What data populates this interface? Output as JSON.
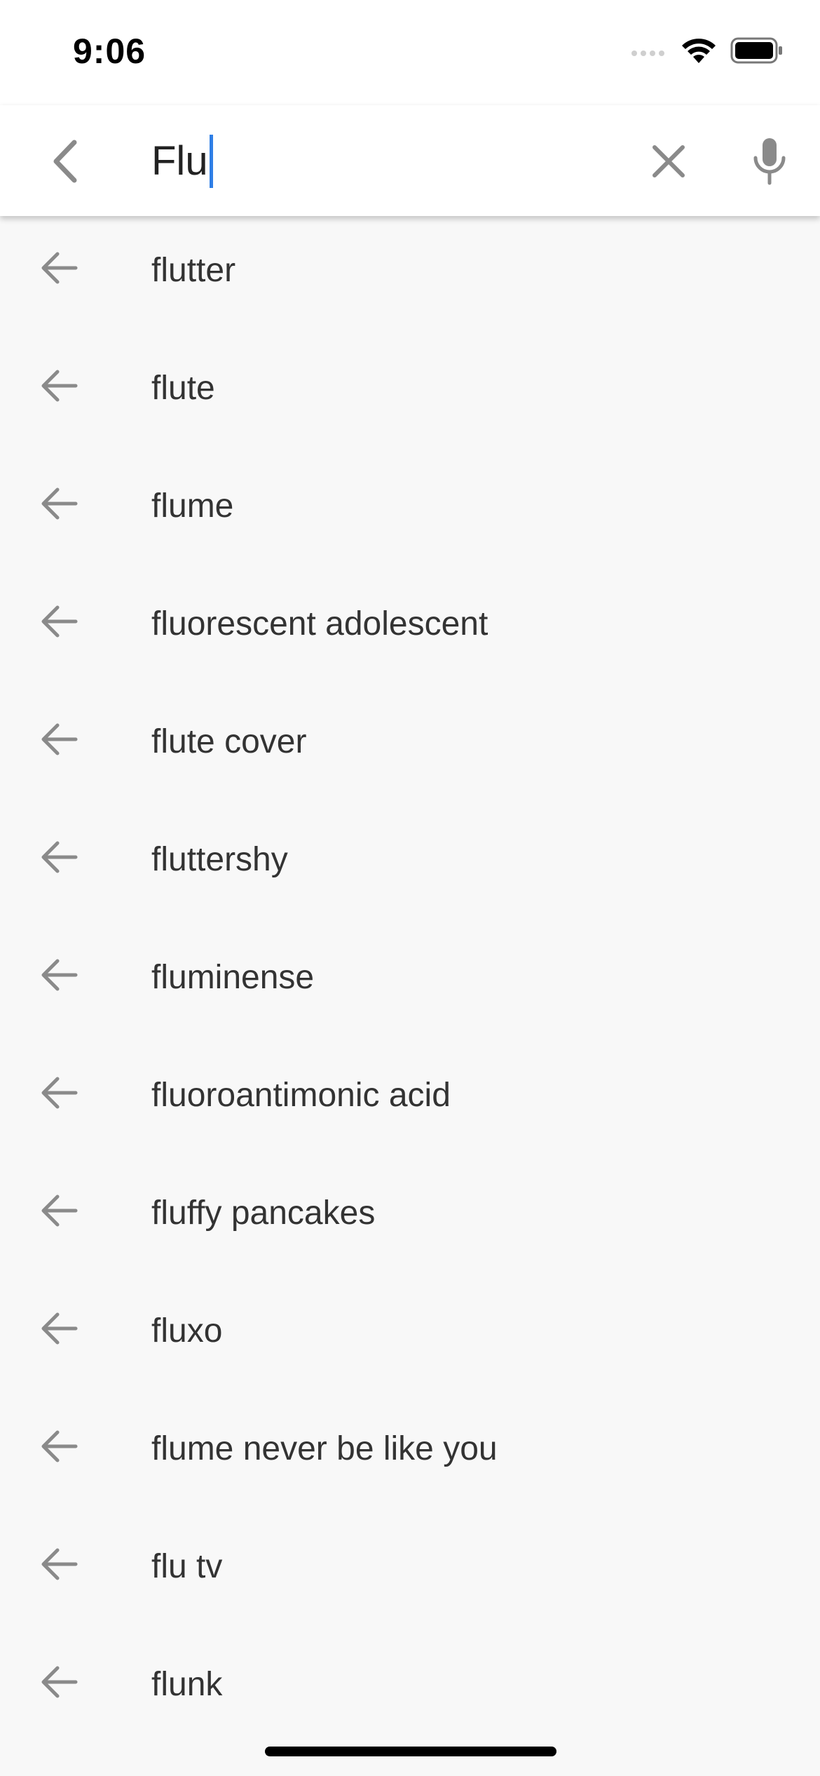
{
  "status_bar": {
    "time": "9:06"
  },
  "search": {
    "query": "Flu",
    "back_icon": "chevron-left-icon",
    "clear_icon": "close-icon",
    "mic_icon": "microphone-icon"
  },
  "suggestions": [
    {
      "label": "flutter"
    },
    {
      "label": "flute"
    },
    {
      "label": "flume"
    },
    {
      "label": "fluorescent adolescent"
    },
    {
      "label": "flute cover"
    },
    {
      "label": "fluttershy"
    },
    {
      "label": "fluminense"
    },
    {
      "label": "fluoroantimonic acid"
    },
    {
      "label": "fluffy pancakes"
    },
    {
      "label": "fluxo"
    },
    {
      "label": "flume never be like you"
    },
    {
      "label": "flu tv"
    },
    {
      "label": "flunk"
    }
  ],
  "colors": {
    "background": "#f8f8f8",
    "header": "#ffffff",
    "icon_gray": "#8a8a8a",
    "caret": "#2f7fe6",
    "text": "#333333"
  }
}
